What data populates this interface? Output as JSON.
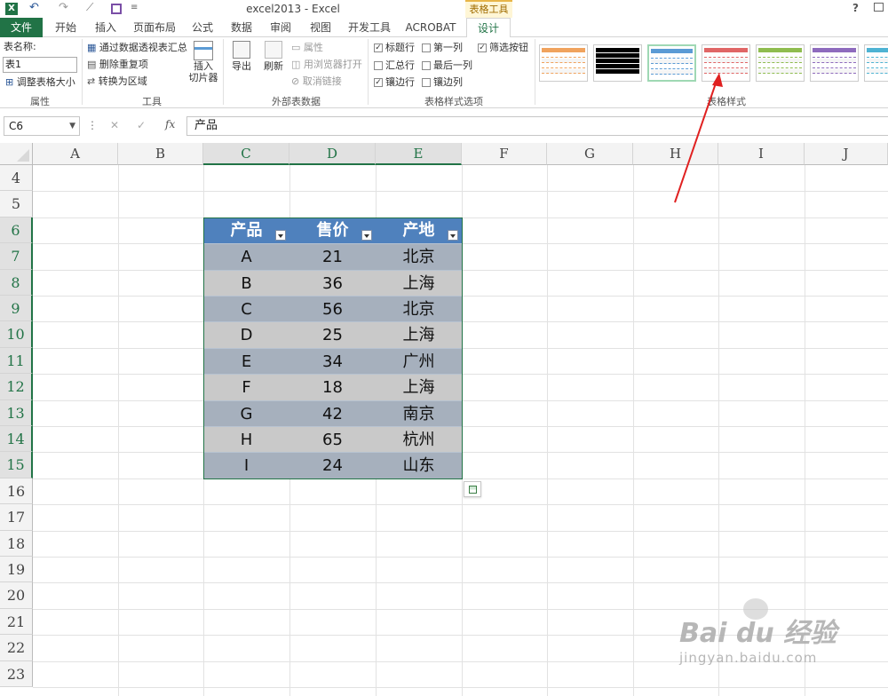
{
  "window": {
    "title": "excel2013 - Excel",
    "help_label": "?",
    "context_tab_group": "表格工具"
  },
  "tabs": [
    "文件",
    "开始",
    "插入",
    "页面布局",
    "公式",
    "数据",
    "审阅",
    "视图",
    "开发工具",
    "ACROBAT",
    "设计"
  ],
  "ribbon": {
    "properties": {
      "label": "表名称:",
      "table_name": "表1",
      "resize": "调整表格大小",
      "group": "属性"
    },
    "tools": {
      "pivot": "通过数据透视表汇总",
      "remove_dup": "删除重复项",
      "convert": "转换为区域",
      "slicer": "插入\n切片器",
      "group": "工具"
    },
    "external": {
      "export": "导出",
      "refresh": "刷新",
      "props": "属性",
      "open_browser": "用浏览器打开",
      "unlink": "取消链接",
      "group": "外部表数据"
    },
    "style_options": {
      "header_row": "标题行",
      "first_col": "第一列",
      "filter_btn": "筛选按钮",
      "total_row": "汇总行",
      "last_col": "最后一列",
      "banded_rows": "镶边行",
      "banded_cols": "镶边列",
      "group": "表格样式选项"
    },
    "styles": {
      "group": "表格样式",
      "swatches": [
        "#f0a35e",
        "#000000",
        "#5b9bd5",
        "#e06666",
        "#8fbc4f",
        "#8e6bbd",
        "#4eb3d3"
      ]
    }
  },
  "formula_bar": {
    "name_box": "C6",
    "cancel": "✕",
    "enter": "✓",
    "fx": "fx",
    "content": "产品"
  },
  "columns": [
    "A",
    "B",
    "C",
    "D",
    "E",
    "F",
    "G",
    "H",
    "I",
    "J"
  ],
  "rows": [
    "4",
    "5",
    "6",
    "7",
    "8",
    "9",
    "10",
    "11",
    "12",
    "13",
    "14",
    "15",
    "16",
    "17",
    "18",
    "19",
    "20",
    "21",
    "22",
    "23"
  ],
  "table": {
    "headers": [
      "产品",
      "售价",
      "产地"
    ],
    "rows": [
      [
        "A",
        "21",
        "北京"
      ],
      [
        "B",
        "36",
        "上海"
      ],
      [
        "C",
        "56",
        "北京"
      ],
      [
        "D",
        "25",
        "上海"
      ],
      [
        "E",
        "34",
        "广州"
      ],
      [
        "F",
        "18",
        "上海"
      ],
      [
        "G",
        "42",
        "南京"
      ],
      [
        "H",
        "65",
        "杭州"
      ],
      [
        "I",
        "24",
        "山东"
      ]
    ],
    "header_color": "#4f81bd",
    "band_color_a": "#a6b0bd",
    "band_color_b": "#c9c9c9"
  },
  "watermark": {
    "brand": "Bai du 经验",
    "url": "jingyan.baidu.com"
  }
}
